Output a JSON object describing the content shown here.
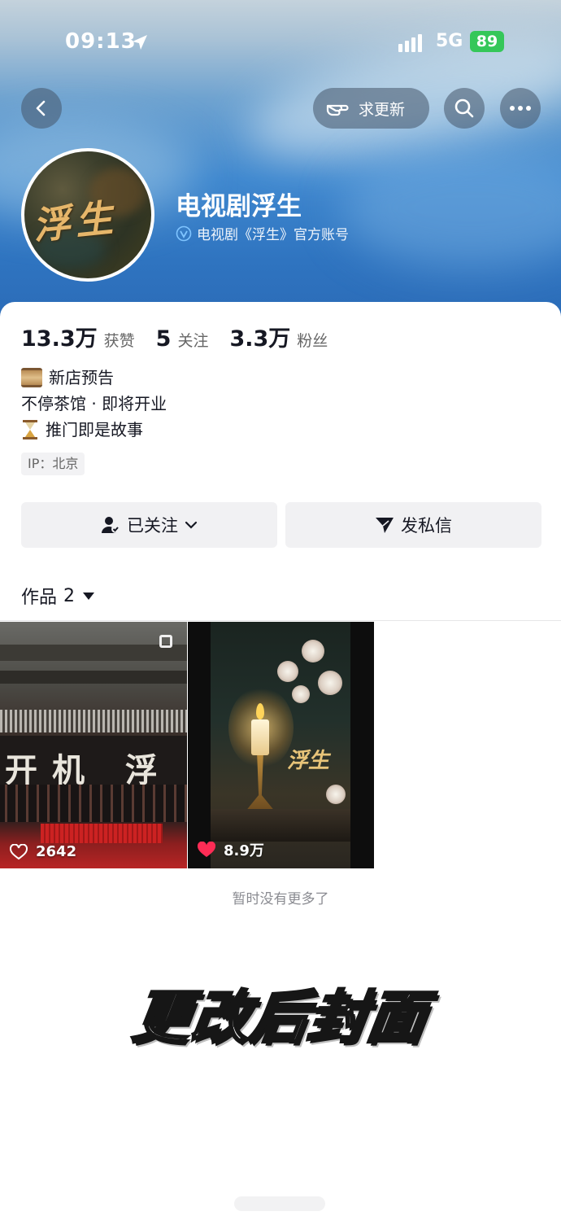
{
  "status_bar": {
    "time": "09:13",
    "network": "5G",
    "battery": "89"
  },
  "header": {
    "request_update_label": "求更新"
  },
  "profile": {
    "name": "电视剧浮生",
    "verification": "电视剧《浮生》官方账号",
    "avatar_text": "浮生"
  },
  "stats": [
    {
      "value": "13.3万",
      "label": "获赞"
    },
    {
      "value": "5",
      "label": "关注"
    },
    {
      "value": "3.3万",
      "label": "粉丝"
    }
  ],
  "bio": [
    "新店预告",
    "不停茶馆 · 即将开业",
    "推门即是故事"
  ],
  "ip_location": "IP：北京",
  "actions": {
    "follow_label": "已关注",
    "message_label": "发私信"
  },
  "works_tab": {
    "label": "作品",
    "count": "2"
  },
  "works": [
    {
      "likes": "2642",
      "liked": false,
      "banner_text": "开机 浮 大"
    },
    {
      "likes": "8.9万",
      "liked": true,
      "title_text": "浮生"
    }
  ],
  "footer_note": "暂时没有更多了",
  "overlay_caption": "更改后封面",
  "colors": {
    "banner_blue": "#3f88cf",
    "battery_green": "#35c759",
    "like_red": "#fe2c55",
    "button_gray": "#f1f1f3"
  }
}
